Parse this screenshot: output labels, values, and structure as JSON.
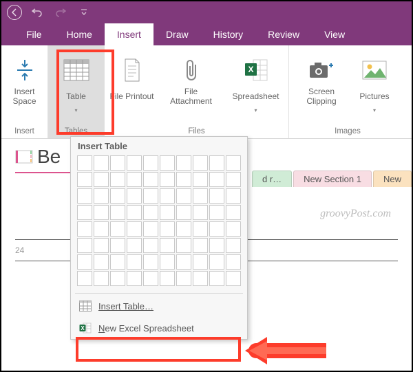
{
  "titlebar": {
    "undo": "↶",
    "redo": "↷"
  },
  "tabs": [
    "File",
    "Home",
    "Insert",
    "Draw",
    "History",
    "Review",
    "View"
  ],
  "activeTab": "Insert",
  "ribbon": {
    "groups": [
      {
        "label": "Insert",
        "items": [
          {
            "label": "Insert Space",
            "drop": false,
            "name": "insert-space-button"
          }
        ]
      },
      {
        "label": "Tables",
        "items": [
          {
            "label": "Table",
            "drop": true,
            "name": "table-button"
          }
        ]
      },
      {
        "label": "Files",
        "items": [
          {
            "label": "File Printout",
            "drop": false,
            "name": "file-printout-button"
          },
          {
            "label": "File Attachment",
            "drop": false,
            "name": "file-attachment-button"
          },
          {
            "label": "Spreadsheet",
            "drop": true,
            "name": "spreadsheet-button"
          }
        ]
      },
      {
        "label": "Images",
        "items": [
          {
            "label": "Screen Clipping",
            "drop": false,
            "name": "screen-clipping-button"
          },
          {
            "label": "Pictures",
            "drop": true,
            "name": "pictures-button"
          }
        ]
      }
    ]
  },
  "page": {
    "titlePrefix": "Be",
    "sections": [
      {
        "label": "d r…",
        "color": "#8fd19e"
      },
      {
        "label": "New Section 1",
        "color": "#f3b6c2"
      },
      {
        "label": "New",
        "color": "#f7c47a"
      }
    ],
    "watermark": "groovyPost.com",
    "datePrefix": "24 "
  },
  "dropdown": {
    "title": "Insert Table",
    "gridCols": 10,
    "gridRows": 8,
    "insertTable": "Insert Table…",
    "newExcel_pre": "N",
    "newExcel_rest": "ew Excel Spreadsheet"
  }
}
